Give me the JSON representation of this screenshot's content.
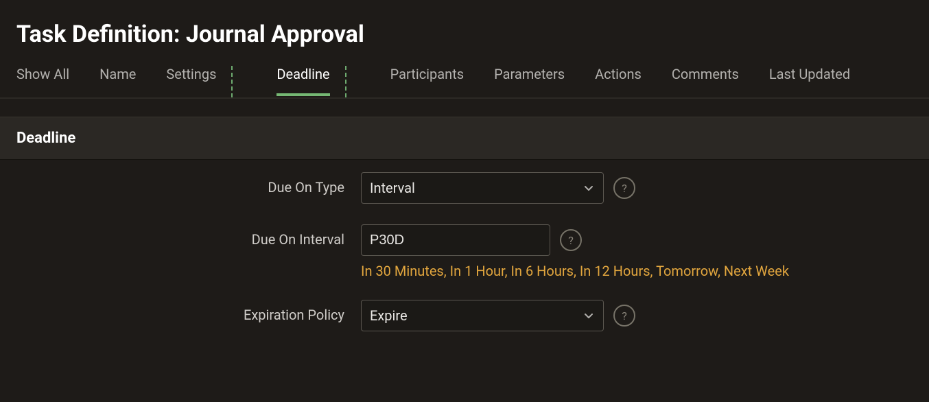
{
  "page_title": "Task Definition: Journal Approval",
  "tabs": {
    "show_all": "Show All",
    "name": "Name",
    "settings": "Settings",
    "deadline": "Deadline",
    "participants": "Participants",
    "parameters": "Parameters",
    "actions": "Actions",
    "comments": "Comments",
    "last_updated": "Last Updated"
  },
  "section_title": "Deadline",
  "form": {
    "due_on_type": {
      "label": "Due On Type",
      "value": "Interval"
    },
    "due_on_interval": {
      "label": "Due On Interval",
      "value": "P30D",
      "hints": [
        "In 30 Minutes",
        "In 1 Hour",
        "In 6 Hours",
        "In 12 Hours",
        "Tomorrow",
        "Next Week"
      ]
    },
    "expiration_policy": {
      "label": "Expiration Policy",
      "value": "Expire"
    }
  },
  "glyphs": {
    "help": "?"
  }
}
